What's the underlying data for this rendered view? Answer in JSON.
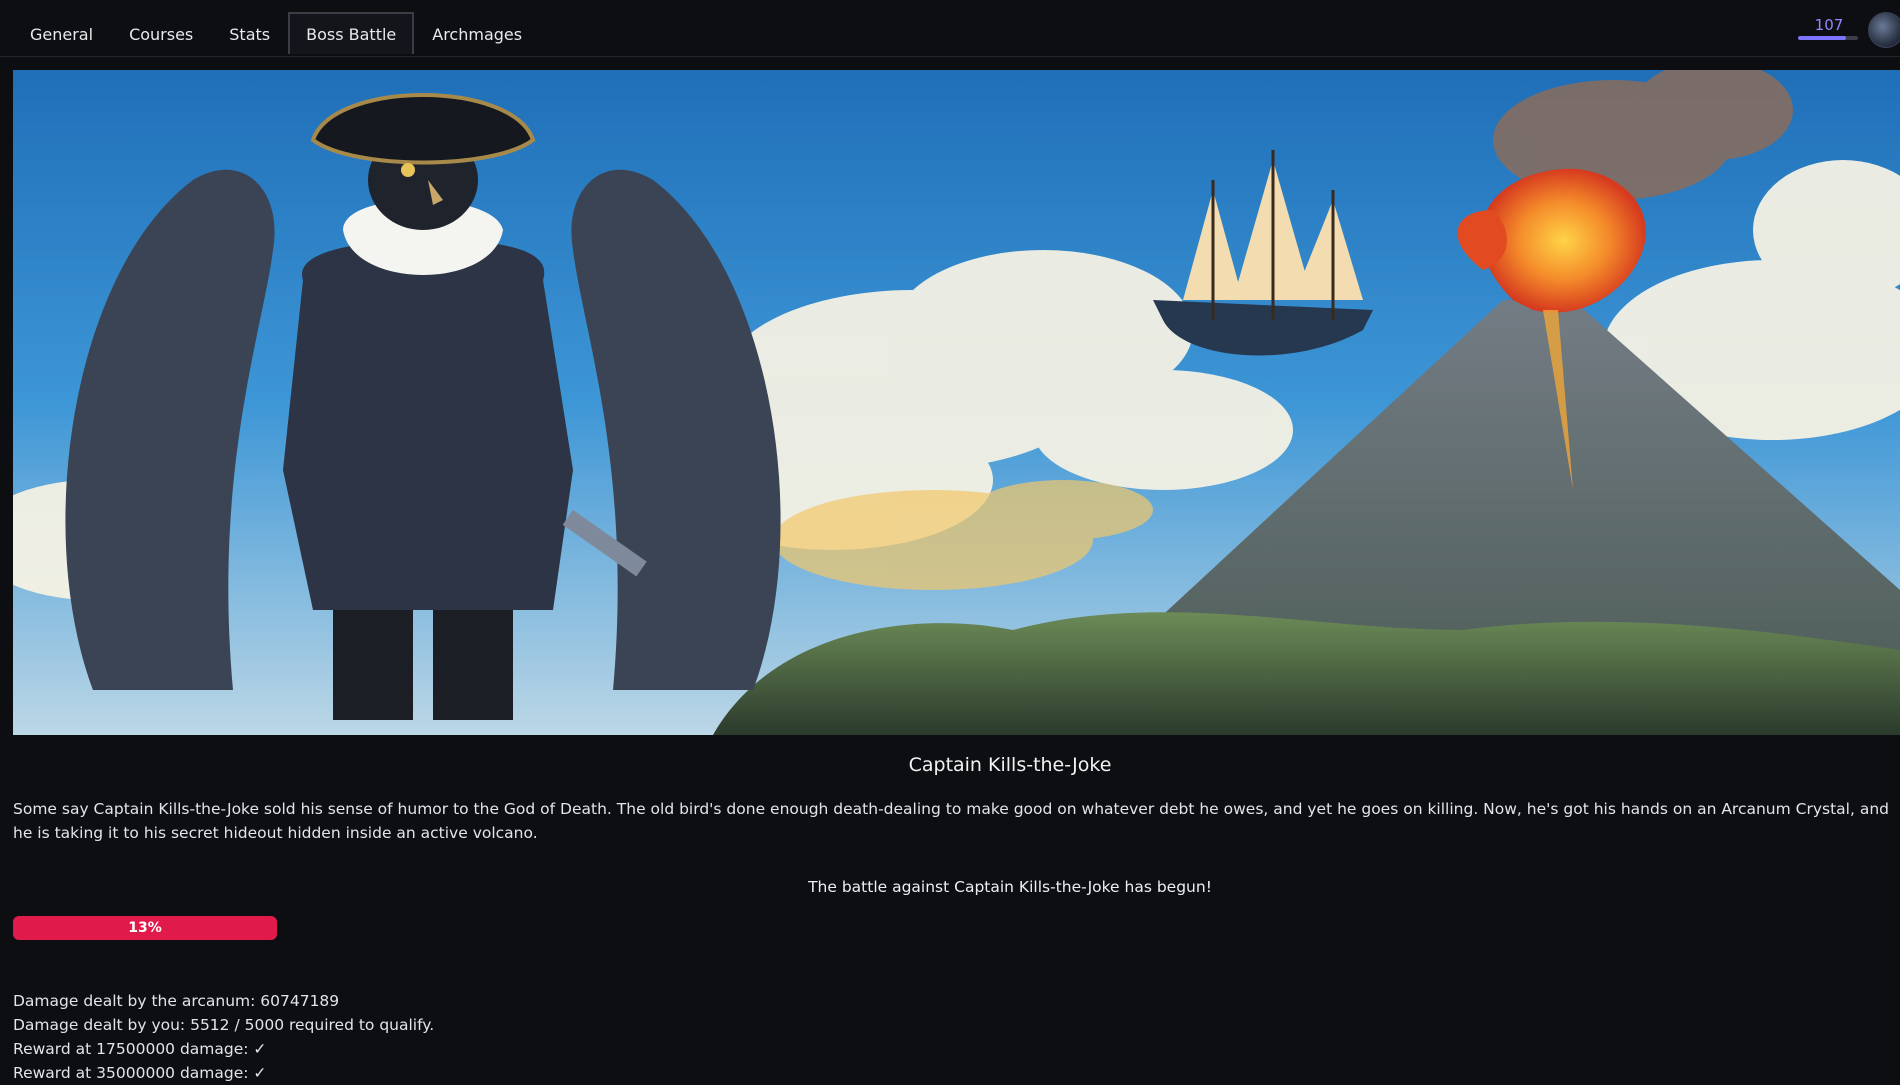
{
  "nav": {
    "tabs": [
      {
        "label": "General"
      },
      {
        "label": "Courses"
      },
      {
        "label": "Stats"
      },
      {
        "label": "Boss Battle"
      },
      {
        "label": "Archmages"
      }
    ],
    "active_tab": "Boss Battle"
  },
  "user": {
    "level": "107",
    "level_progress": 0.8,
    "avatar_icon": "user-avatar"
  },
  "boss": {
    "name": "Captain Kills-the-Joke",
    "description": "Some say Captain Kills-the-Joke sold his sense of humor to the God of Death. The old bird's done enough death-dealing to make good on whatever debt he owes, and yet he goes on killing. Now, he's got his hands on an Arcanum Crystal, and he is taking it to his secret hideout hidden inside an active volcano.",
    "battle_status": "The battle against Captain Kills-the-Joke has begun!",
    "progress_label": "13%",
    "progress": 0.13
  },
  "stats": {
    "arcanum_damage": "Damage dealt by the arcanum: 60747189",
    "your_damage": "Damage dealt by you: 5512 / 5000 required to qualify.",
    "reward_1": "Reward at 17500000 damage: ✓",
    "reward_2": "Reward at 35000000 damage: ✓"
  },
  "colors": {
    "background": "#0d0e12",
    "accent_level": "#8f88ff",
    "progress_bar": "#e01b4c"
  }
}
